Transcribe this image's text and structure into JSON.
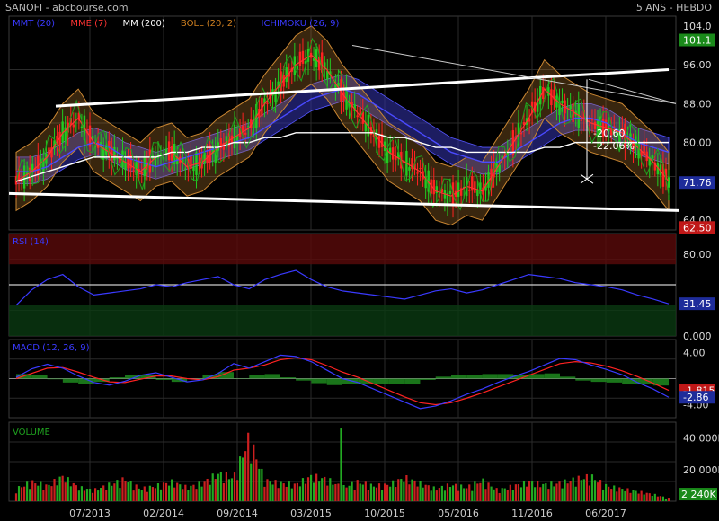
{
  "header": {
    "title": "SANOFI - abcbourse.com",
    "period": "5 ANS - HEBDO"
  },
  "legend": [
    {
      "label": "MMT (20)",
      "color": "#3a3aff"
    },
    {
      "label": "MME (7)",
      "color": "#ff3333"
    },
    {
      "label": "MM (200)",
      "color": "#ffffff"
    },
    {
      "label": "BOLL (20, 2)",
      "color": "#d08020"
    },
    {
      "label": "ICHIMOKU (26, 9)",
      "color": "#3a3aff"
    }
  ],
  "colors": {
    "up": "#22cc22",
    "down": "#ff2222",
    "boll": "#cc8833",
    "cloud": "#3434b0",
    "grid": "#2a2a2a",
    "badge_green": "#1a8a1a",
    "badge_red": "#c01818",
    "badge_blue": "#1e2c9a"
  },
  "x_ticks": [
    "07/2013",
    "02/2014",
    "09/2014",
    "03/2015",
    "10/2015",
    "05/2016",
    "11/2016",
    "06/2017"
  ],
  "chart_data": [
    {
      "type": "line",
      "panel": "price",
      "y_ticks": [
        "104.0",
        "96.00",
        "88.00",
        "80.00",
        "72.00",
        "64.00"
      ],
      "ylim": [
        62,
        106
      ],
      "series": [
        {
          "name": "MMT (20)",
          "values": [
            74,
            74,
            75,
            77,
            79,
            80,
            79,
            77,
            76,
            75,
            76,
            77,
            78,
            79,
            80,
            81,
            83,
            85,
            87,
            89,
            90,
            91,
            90,
            88,
            86,
            84,
            82,
            80,
            78,
            77,
            76,
            76,
            78,
            80,
            82,
            84,
            85,
            85,
            84,
            82,
            80,
            79,
            78
          ]
        },
        {
          "name": "MME (7)",
          "values": [
            72,
            74,
            77,
            82,
            85,
            80,
            78,
            76,
            74,
            77,
            78,
            75,
            76,
            79,
            81,
            83,
            88,
            92,
            96,
            98,
            95,
            90,
            86,
            82,
            78,
            76,
            74,
            70,
            69,
            71,
            70,
            75,
            80,
            85,
            91,
            88,
            86,
            84,
            83,
            82,
            79,
            76,
            72
          ]
        },
        {
          "name": "MM (200)",
          "values": [
            72,
            73,
            74,
            75,
            76,
            77,
            77,
            77,
            77,
            77,
            78,
            78,
            79,
            79,
            80,
            80,
            81,
            81,
            82,
            82,
            82,
            82,
            82,
            82,
            81,
            81,
            80,
            79,
            79,
            78,
            78,
            78,
            78,
            78,
            79,
            79,
            80,
            80,
            80,
            80,
            80,
            80,
            80
          ]
        }
      ],
      "price_labels": [
        {
          "label": "101.1",
          "color": "#1a8a1a"
        },
        {
          "label": "71.76",
          "color": "#1e2c9a"
        },
        {
          "label": "62.50",
          "color": "#c01818"
        }
      ],
      "annotation": {
        "change": "-20.60",
        "pct": "-22.06%"
      }
    },
    {
      "type": "line",
      "panel": "rsi",
      "title": "RSI (14)",
      "y_ticks": [
        "80.00",
        "0.000"
      ],
      "ylim": [
        0,
        100
      ],
      "levels": [
        70,
        30
      ],
      "series": [
        {
          "name": "RSI (14)",
          "values": [
            30,
            45,
            55,
            60,
            48,
            40,
            42,
            44,
            46,
            50,
            48,
            52,
            55,
            58,
            50,
            46,
            55,
            60,
            64,
            55,
            48,
            44,
            42,
            40,
            38,
            36,
            40,
            44,
            46,
            42,
            45,
            50,
            55,
            60,
            58,
            56,
            52,
            50,
            48,
            45,
            40,
            36,
            31.45
          ]
        }
      ],
      "last_label": "31.45"
    },
    {
      "type": "line",
      "panel": "macd",
      "title": "MACD (12, 26, 9)",
      "y_ticks": [
        "4.00",
        "-4.00"
      ],
      "ylim": [
        -6,
        6
      ],
      "series": [
        {
          "name": "MACD",
          "values": [
            0.2,
            1.5,
            2.2,
            1.6,
            0.4,
            -0.6,
            -1.0,
            -0.4,
            0.5,
            0.9,
            0.2,
            -0.5,
            -0.2,
            0.8,
            2.3,
            1.6,
            2.6,
            3.6,
            3.4,
            2.6,
            1.3,
            0.0,
            -0.6,
            -1.6,
            -2.6,
            -3.6,
            -4.6,
            -4.2,
            -3.4,
            -2.4,
            -1.6,
            -0.6,
            0.3,
            1.1,
            2.1,
            3.1,
            2.9,
            2.1,
            1.4,
            0.6,
            -0.6,
            -1.6,
            -2.86
          ]
        },
        {
          "name": "Signal",
          "values": [
            0.0,
            0.8,
            1.6,
            1.7,
            1.0,
            0.2,
            -0.5,
            -0.6,
            -0.1,
            0.4,
            0.4,
            0.0,
            -0.2,
            0.3,
            1.3,
            1.6,
            2.1,
            2.9,
            3.2,
            2.9,
            2.0,
            1.0,
            0.2,
            -0.8,
            -1.8,
            -2.8,
            -3.7,
            -4.0,
            -3.7,
            -3.0,
            -2.2,
            -1.3,
            -0.4,
            0.5,
            1.4,
            2.3,
            2.6,
            2.4,
            1.9,
            1.2,
            0.3,
            -0.7,
            -1.8
          ]
        }
      ],
      "last_labels": [
        {
          "label": "-1.815",
          "color": "#c01818"
        },
        {
          "label": "-2.86",
          "color": "#1e2c9a"
        }
      ]
    },
    {
      "type": "bar",
      "panel": "volume",
      "title": "VOLUME",
      "y_ticks": [
        "40 000K",
        "20 000K"
      ],
      "ylim": [
        0,
        50000
      ],
      "values": [
        9000,
        14000,
        11000,
        18000,
        10000,
        8000,
        12000,
        16000,
        9000,
        11000,
        14000,
        10000,
        13000,
        20000,
        17000,
        46000,
        15000,
        13000,
        12000,
        18000,
        16000,
        10000,
        14000,
        11000,
        12000,
        17000,
        13000,
        9000,
        12000,
        10000,
        15000,
        8000,
        11000,
        14000,
        12000,
        13000,
        16000,
        18000,
        11000,
        9000,
        7000,
        5000,
        2240
      ],
      "last_label": "2 240K"
    }
  ]
}
